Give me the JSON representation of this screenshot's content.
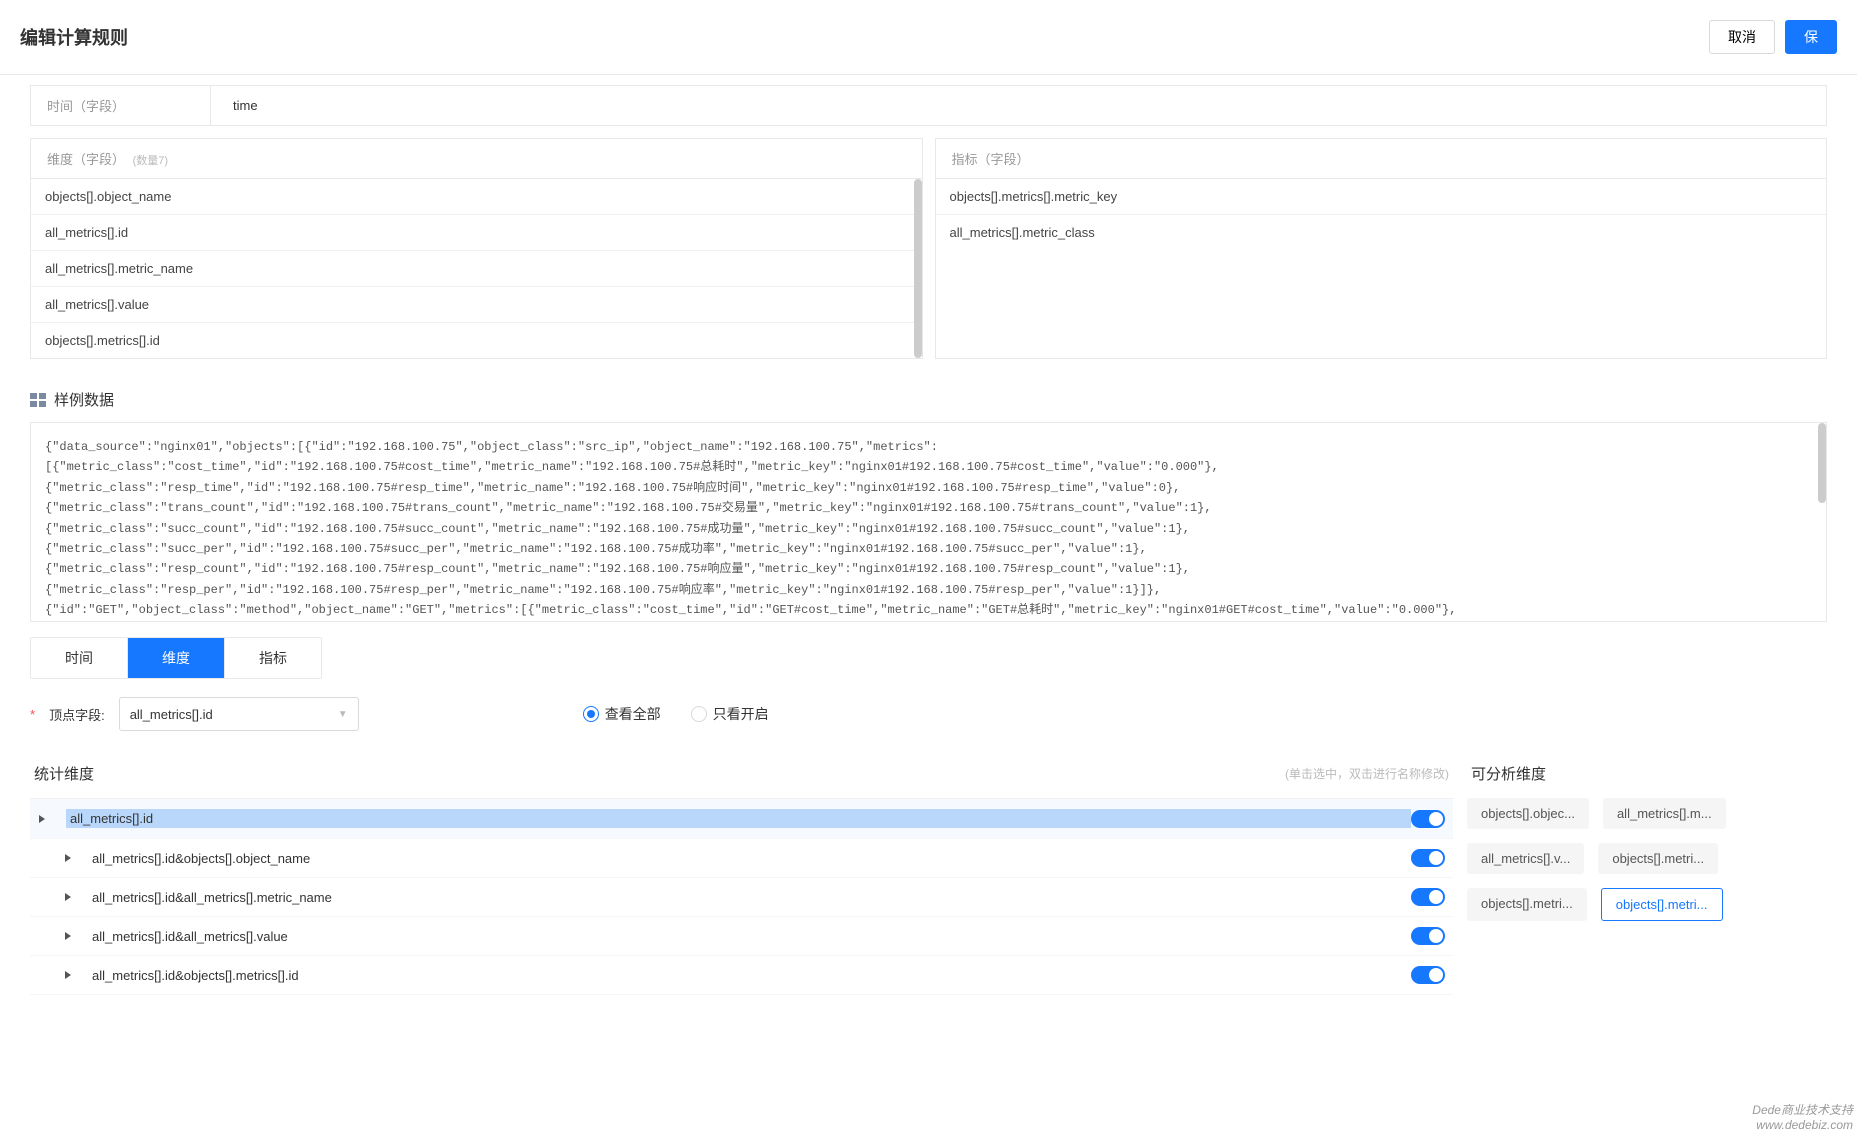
{
  "header": {
    "title": "编辑计算规则",
    "cancel": "取消",
    "save": "保"
  },
  "time": {
    "label": "时间（字段）",
    "value": "time"
  },
  "dimension": {
    "header": "维度（字段）",
    "count_hint": "(数量7)",
    "items": [
      "objects[].object_name",
      "all_metrics[].id",
      "all_metrics[].metric_name",
      "all_metrics[].value",
      "objects[].metrics[].id"
    ]
  },
  "metric": {
    "header": "指标（字段）",
    "items": [
      "objects[].metrics[].metric_key",
      "all_metrics[].metric_class"
    ]
  },
  "sample": {
    "title": "样例数据",
    "text": "{\"data_source\":\"nginx01\",\"objects\":[{\"id\":\"192.168.100.75\",\"object_class\":\"src_ip\",\"object_name\":\"192.168.100.75\",\"metrics\":\n[{\"metric_class\":\"cost_time\",\"id\":\"192.168.100.75#cost_time\",\"metric_name\":\"192.168.100.75#总耗时\",\"metric_key\":\"nginx01#192.168.100.75#cost_time\",\"value\":\"0.000\"},\n{\"metric_class\":\"resp_time\",\"id\":\"192.168.100.75#resp_time\",\"metric_name\":\"192.168.100.75#响应时间\",\"metric_key\":\"nginx01#192.168.100.75#resp_time\",\"value\":0},\n{\"metric_class\":\"trans_count\",\"id\":\"192.168.100.75#trans_count\",\"metric_name\":\"192.168.100.75#交易量\",\"metric_key\":\"nginx01#192.168.100.75#trans_count\",\"value\":1},\n{\"metric_class\":\"succ_count\",\"id\":\"192.168.100.75#succ_count\",\"metric_name\":\"192.168.100.75#成功量\",\"metric_key\":\"nginx01#192.168.100.75#succ_count\",\"value\":1},\n{\"metric_class\":\"succ_per\",\"id\":\"192.168.100.75#succ_per\",\"metric_name\":\"192.168.100.75#成功率\",\"metric_key\":\"nginx01#192.168.100.75#succ_per\",\"value\":1},\n{\"metric_class\":\"resp_count\",\"id\":\"192.168.100.75#resp_count\",\"metric_name\":\"192.168.100.75#响应量\",\"metric_key\":\"nginx01#192.168.100.75#resp_count\",\"value\":1},\n{\"metric_class\":\"resp_per\",\"id\":\"192.168.100.75#resp_per\",\"metric_name\":\"192.168.100.75#响应率\",\"metric_key\":\"nginx01#192.168.100.75#resp_per\",\"value\":1}]},\n{\"id\":\"GET\",\"object_class\":\"method\",\"object_name\":\"GET\",\"metrics\":[{\"metric_class\":\"cost_time\",\"id\":\"GET#cost_time\",\"metric_name\":\"GET#总耗时\",\"metric_key\":\"nginx01#GET#cost_time\",\"value\":\"0.000\"},"
  },
  "tabs": [
    "时间",
    "维度",
    "指标"
  ],
  "active_tab": 1,
  "top_field": {
    "label": "顶点字段:",
    "value": "all_metrics[].id"
  },
  "radios": {
    "all": "查看全部",
    "enabled": "只看开启"
  },
  "stat_dim": {
    "header": "统计维度",
    "hint": "(单击选中，双击进行名称修改)",
    "items": [
      {
        "label": "all_metrics[].id",
        "indent": 0,
        "selected": true
      },
      {
        "label": "all_metrics[].id&objects[].object_name",
        "indent": 1
      },
      {
        "label": "all_metrics[].id&all_metrics[].metric_name",
        "indent": 1
      },
      {
        "label": "all_metrics[].id&all_metrics[].value",
        "indent": 1
      },
      {
        "label": "all_metrics[].id&objects[].metrics[].id",
        "indent": 1
      }
    ]
  },
  "analyzable": {
    "header": "可分析维度",
    "tags": [
      {
        "label": "objects[].objec..."
      },
      {
        "label": "all_metrics[].m..."
      },
      {
        "label": "all_metrics[].v..."
      },
      {
        "label": "objects[].metri..."
      },
      {
        "label": "objects[].metri..."
      },
      {
        "label": "objects[].metri...",
        "selected": true
      }
    ]
  },
  "watermark": {
    "line1": "Dede商业技术支持",
    "line2": "www.dedebiz.com"
  }
}
